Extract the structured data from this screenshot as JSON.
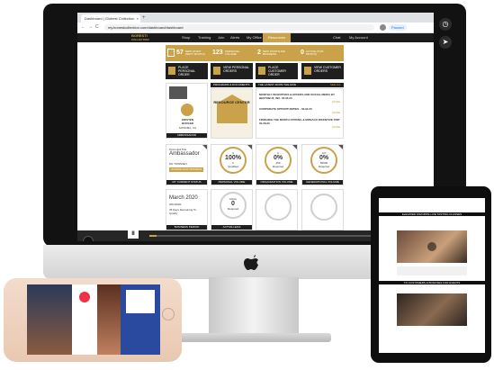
{
  "browser": {
    "tab_title": "Dashboard | Globest Collection",
    "tab_close": "×",
    "tab_new": "+",
    "url": "my.bonestcollection.com/dashboard/dashboard",
    "status": "Paused",
    "back": "←",
    "forward": "→",
    "reload": "C"
  },
  "site": {
    "logo_line1": "BORESTI",
    "logo_line2": "COLLECTION",
    "nav": [
      "Shop",
      "Training",
      "Join",
      "Alerts",
      "My Office",
      "Resources"
    ],
    "active_nav": "Resources",
    "nav_right": [
      "Chat",
      "My Account"
    ]
  },
  "stats": [
    {
      "num": "57",
      "label": "NEW START (NEXT MONTH)"
    },
    {
      "num": "123",
      "label": "PERSONAL VOLUME"
    },
    {
      "num": "2",
      "label": "NEW FRONTLINE BUSINESS"
    },
    {
      "num": "0",
      "label": "ACTIVE (THIS MONTH)"
    }
  ],
  "tiles": [
    {
      "label": "PLACE PERSONAL ORDER"
    },
    {
      "label": "VIEW PERSONAL ORDERS"
    },
    {
      "label": "PLACE CUSTOMER ORDER"
    },
    {
      "label": "VIEW CUSTOMER ORDERS"
    }
  ],
  "sections": {
    "programs": "PROGRAMS & DOCUMENTS",
    "news": "THE LATEST FROM THE HIVE",
    "see_all": "SEE ALL"
  },
  "news_items": [
    {
      "title": "MONTHLY INCENTIVES & OFFERS AND SOCIAL MEDIA BY BESTOBUZ, INC. 03.05.20",
      "more": "MORE"
    },
    {
      "title": "CORPORATE OPPORTUNITIES - 03.02.20",
      "more": "MORE"
    },
    {
      "title": "FINISHING THE MONTH STRONG & MONACO INCENTIVE TRIP 02.28.20",
      "more": "MORE"
    }
  ],
  "ambassador": {
    "name_line1": "KRISTEN",
    "name_line2": "BURGER",
    "location": "SONOMA, CA",
    "label": "AMBASSADOR",
    "resource_center": "RESOURCE CENTER"
  },
  "rank": {
    "promoted_title": "Promoted Title",
    "title": "Ambassador",
    "sponsor": "DN TOWNSEY",
    "upgrade": "UPGRADE RANK PROGRESS",
    "card_label": "MY CURRENT STATUS"
  },
  "circles": [
    {
      "top": "0",
      "big": "100%",
      "sub": "0",
      "bottom": "Qualified",
      "label": "PERSONAL VOLUME",
      "grey": false
    },
    {
      "top": "0",
      "big": "0%",
      "sub": "250",
      "bottom": "Required",
      "label": "ORGANIZATION VOLUME",
      "grey": false
    },
    {
      "top": "127",
      "big": "0%",
      "sub": "50000",
      "bottom": "Required",
      "label": "GENERATIONAL VOLUME",
      "grey": false
    }
  ],
  "date_card": {
    "month": "March 2020",
    "range": "3/01/2020",
    "note": "35 Days Remaining To Qualify",
    "label": "BUSINESS PERIOD"
  },
  "active_card": {
    "top": "Active",
    "big": "0",
    "bottom": "Required",
    "label": "ACTIVE LEGS"
  },
  "video": {
    "pause": "II"
  },
  "tablet": {
    "header1": "ELEVATED FAVORITE LIVE TASTING CLASSES",
    "header2": "TO CUSTOMERS & BONUSES FOR EVENTS"
  },
  "colors": {
    "gold": "#c9a24a",
    "dark": "#1f1f1f"
  }
}
